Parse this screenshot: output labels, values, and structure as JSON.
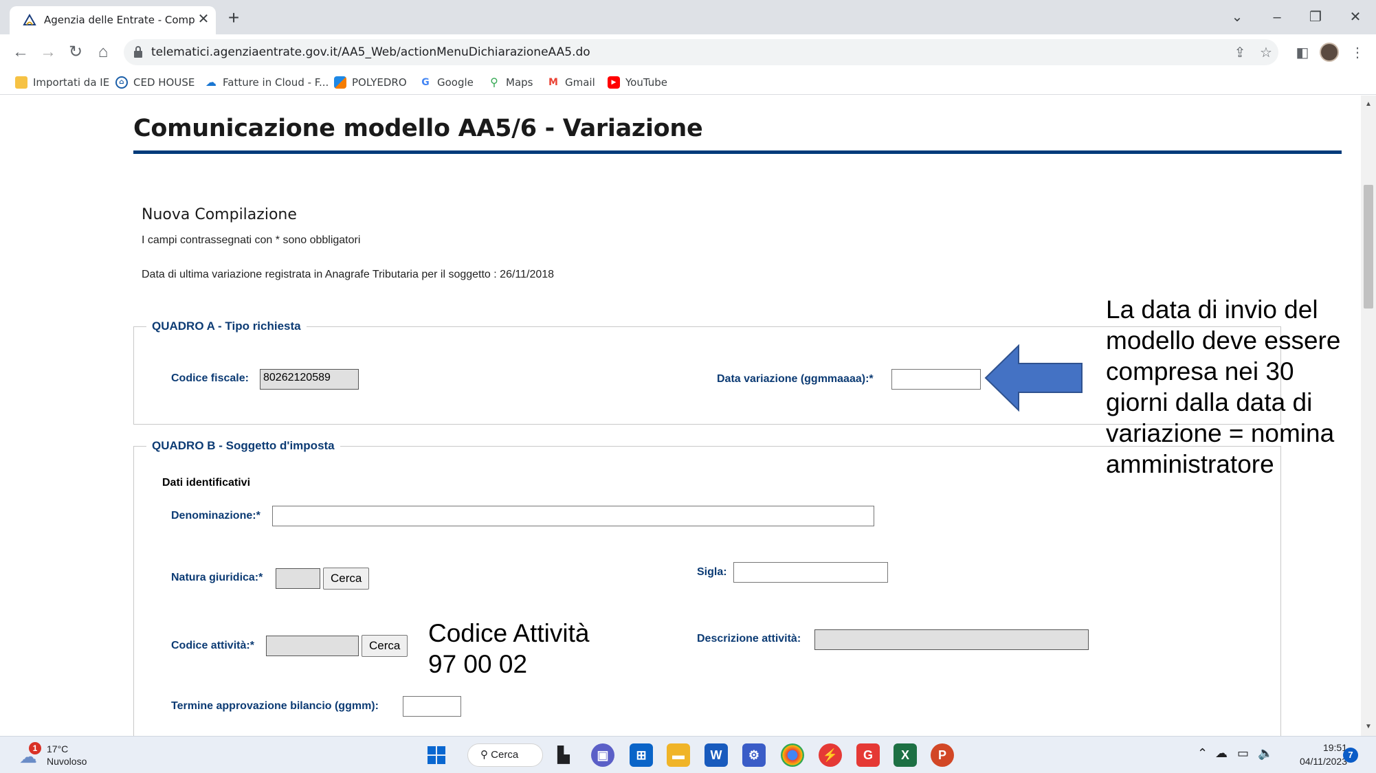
{
  "browser": {
    "tab_title": "Agenzia delle Entrate - Compila",
    "url": "telematici.agenziaentrate.gov.it/AA5_Web/actionMenuDichiarazioneAA5.do",
    "bookmarks": [
      {
        "label": "Importati da IE",
        "icon": "folder-icon",
        "color": "#f6c244"
      },
      {
        "label": "CED HOUSE",
        "icon": "house-lock-icon",
        "color": "#1a5ea8"
      },
      {
        "label": "Fatture in Cloud - F...",
        "icon": "cloud-icon",
        "color": "#1976d2"
      },
      {
        "label": "POLYEDRO",
        "icon": "polyedro-icon",
        "color": "#1e88e5"
      },
      {
        "label": "Google",
        "icon": "google-icon",
        "color": "#4285f4"
      },
      {
        "label": "Maps",
        "icon": "maps-pin-icon",
        "color": "#34a853"
      },
      {
        "label": "Gmail",
        "icon": "gmail-icon",
        "color": "#ea4335"
      },
      {
        "label": "YouTube",
        "icon": "youtube-icon",
        "color": "#ff0000"
      }
    ]
  },
  "page": {
    "title": "Comunicazione modello AA5/6 - Variazione",
    "section_title": "Nuova Compilazione",
    "required_note": "I campi contrassegnati con * sono obbligatori",
    "last_variation_note": "Data di ultima variazione registrata in Anagrafe Tributaria per il soggetto : 26/11/2018",
    "accent_color": "#003b7a"
  },
  "quadro_a": {
    "legend": "QUADRO A - Tipo richiesta",
    "codice_fiscale_label": "Codice fiscale:",
    "codice_fiscale_value": "80262120589",
    "data_variazione_label": "Data variazione (ggmmaaaa):*",
    "data_variazione_value": ""
  },
  "quadro_b": {
    "legend": "QUADRO B - Soggetto d'imposta",
    "subheading": "Dati identificativi",
    "denominazione_label": "Denominazione:*",
    "natura_giuridica_label": "Natura giuridica:*",
    "sigla_label": "Sigla:",
    "codice_attivita_label": "Codice attività:*",
    "descrizione_attivita_label": "Descrizione attività:",
    "termine_label": "Termine approvazione bilancio (ggmm):",
    "cerca_label": "Cerca"
  },
  "annotations": {
    "invio_line1": "La data di invio del",
    "invio_line2": "modello deve essere",
    "invio_line3": "compresa nei 30",
    "invio_line4": "giorni dalla data di",
    "invio_line5": "variazione = nomina",
    "invio_line6": "amministratore",
    "codice_line1": "Codice Attività",
    "codice_line2": "97 00 02",
    "arrow_color": "#4472c4"
  },
  "taskbar": {
    "temperature": "17°C",
    "weather": "Nuvoloso",
    "weather_badge": "1",
    "search_label": "Cerca",
    "time": "19:51",
    "date": "04/11/2023",
    "notifications": "7"
  }
}
